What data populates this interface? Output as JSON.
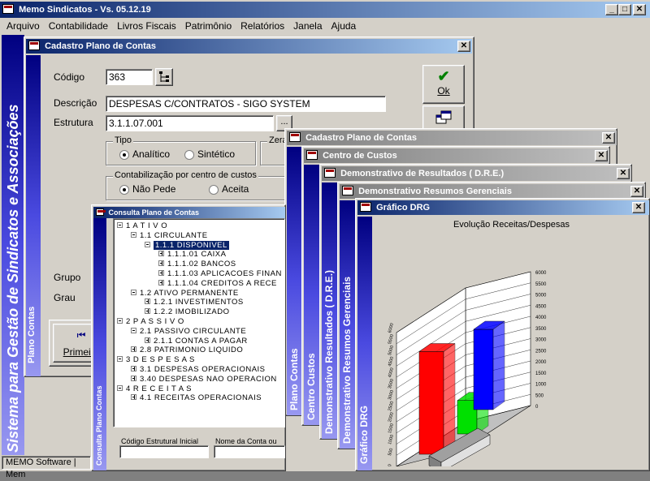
{
  "app": {
    "title": "Memo Sindicatos - Vs. 05.12.19",
    "menu": [
      "Arquivo",
      "Contabilidade",
      "Livros Fiscais",
      "Patrimônio",
      "Relatórios",
      "Janela",
      "Ajuda"
    ],
    "sidebar_title": "Sistema para Gestão de Sindicatos e Associações",
    "status_text": "MEMO Software | Mem"
  },
  "cadastro": {
    "title": "Cadastro Plano de Contas",
    "side_label": "Plano Contas",
    "codigo_label": "Código",
    "codigo_value": "363",
    "descricao_label": "Descrição",
    "descricao_value": "DESPESAS C/CONTRATOS - SIGO SYSTEM",
    "estrutura_label": "Estrutura",
    "estrutura_value": "3.1.1.07.001",
    "browse_label": "...",
    "tipo_label": "Tipo",
    "tipo_options": [
      "Analítico",
      "Sintético"
    ],
    "tipo_selected": "Analítico",
    "zerar_label": "Zera",
    "contab_label": "Contabilização por centro de custos",
    "contab_options": [
      "Não Pede",
      "Aceita"
    ],
    "contab_selected": "Não Pede",
    "grupo_label": "Grupo",
    "grau_label": "Grau",
    "ok_label": "Ok",
    "primeiro_label": "Primeiro"
  },
  "consulta": {
    "title": "Consulta Plano de Contas",
    "side_label": "Consulta Plano Contas",
    "tree": [
      {
        "level": 0,
        "text": "1  A T I V O",
        "expanded": true
      },
      {
        "level": 1,
        "text": "1.1  CIRCULANTE",
        "expanded": true
      },
      {
        "level": 2,
        "text": "1.1.1  DISPONIVEL",
        "expanded": true,
        "selected": true
      },
      {
        "level": 3,
        "text": "1.1.1.01  CAIXA",
        "expanded": false
      },
      {
        "level": 3,
        "text": "1.1.1.02  BANCOS",
        "expanded": false
      },
      {
        "level": 3,
        "text": "1.1.1.03  APLICACOES FINAN",
        "expanded": false
      },
      {
        "level": 3,
        "text": "1.1.1.04  CREDITOS A RECE",
        "expanded": false
      },
      {
        "level": 1,
        "text": "1.2  ATIVO PERMANENTE",
        "expanded": true
      },
      {
        "level": 2,
        "text": "1.2.1  INVESTIMENTOS",
        "expanded": false
      },
      {
        "level": 2,
        "text": "1.2.2  IMOBILIZADO",
        "expanded": false
      },
      {
        "level": 0,
        "text": "2  P A S S I V O",
        "expanded": true
      },
      {
        "level": 1,
        "text": "2.1  PASSIVO CIRCULANTE",
        "expanded": true
      },
      {
        "level": 2,
        "text": "2.1.1  CONTAS A PAGAR",
        "expanded": false
      },
      {
        "level": 1,
        "text": "2.8  PATRIMONIO LIQUIDO",
        "expanded": false
      },
      {
        "level": 0,
        "text": "3  D E S P E S A S",
        "expanded": true
      },
      {
        "level": 1,
        "text": "3.1  DESPESAS OPERACIONAIS",
        "expanded": false
      },
      {
        "level": 1,
        "text": "3.40  DESPESAS NAO OPERACION",
        "expanded": false
      },
      {
        "level": 0,
        "text": "4  R E C E I T A S",
        "expanded": true
      },
      {
        "level": 1,
        "text": "4.1  RECEITAS OPERACIONAIS",
        "expanded": false
      }
    ],
    "codigo_estrutural_label": "Código Estrutural Inicial",
    "nome_conta_label": "Nome da Conta ou Descrição"
  },
  "cascade": [
    {
      "title": "Cadastro Plano de Contas",
      "side": "Plano Contas"
    },
    {
      "title": "Centro de Custos",
      "side": "Centro Custos"
    },
    {
      "title": "Demonstrativo de Resultados ( D.R.E.)",
      "side": "Demonstrativo Resultados ( D.R.E.)"
    },
    {
      "title": "Demonstrativo Resumos Gerenciais",
      "side": "Demonstrativo Resumos Gerenciais"
    }
  ],
  "grafico": {
    "title": "Gráfico DRG",
    "side_label": "Gráfico DRG"
  },
  "chart_data": {
    "type": "bar",
    "title": "Evolução Receitas/Despesas",
    "y_ticks": [
      0,
      500,
      1000,
      1500,
      2000,
      2500,
      3000,
      3500,
      4000,
      4500,
      5000,
      5500,
      6000
    ],
    "ylim": [
      0,
      6000
    ],
    "categories": [
      "",
      ""
    ],
    "series": [
      {
        "values": [
          4600
        ],
        "color": "#ff0000"
      },
      {
        "values": [
          1500
        ],
        "color": "#00e000"
      },
      {
        "values": [
          3600
        ],
        "color": "#0000ff"
      }
    ],
    "grid": true
  },
  "colors": {
    "title_active": "#0a246a",
    "title_inactive": "#808080",
    "face": "#d4d0c8",
    "strip": "#000080"
  }
}
